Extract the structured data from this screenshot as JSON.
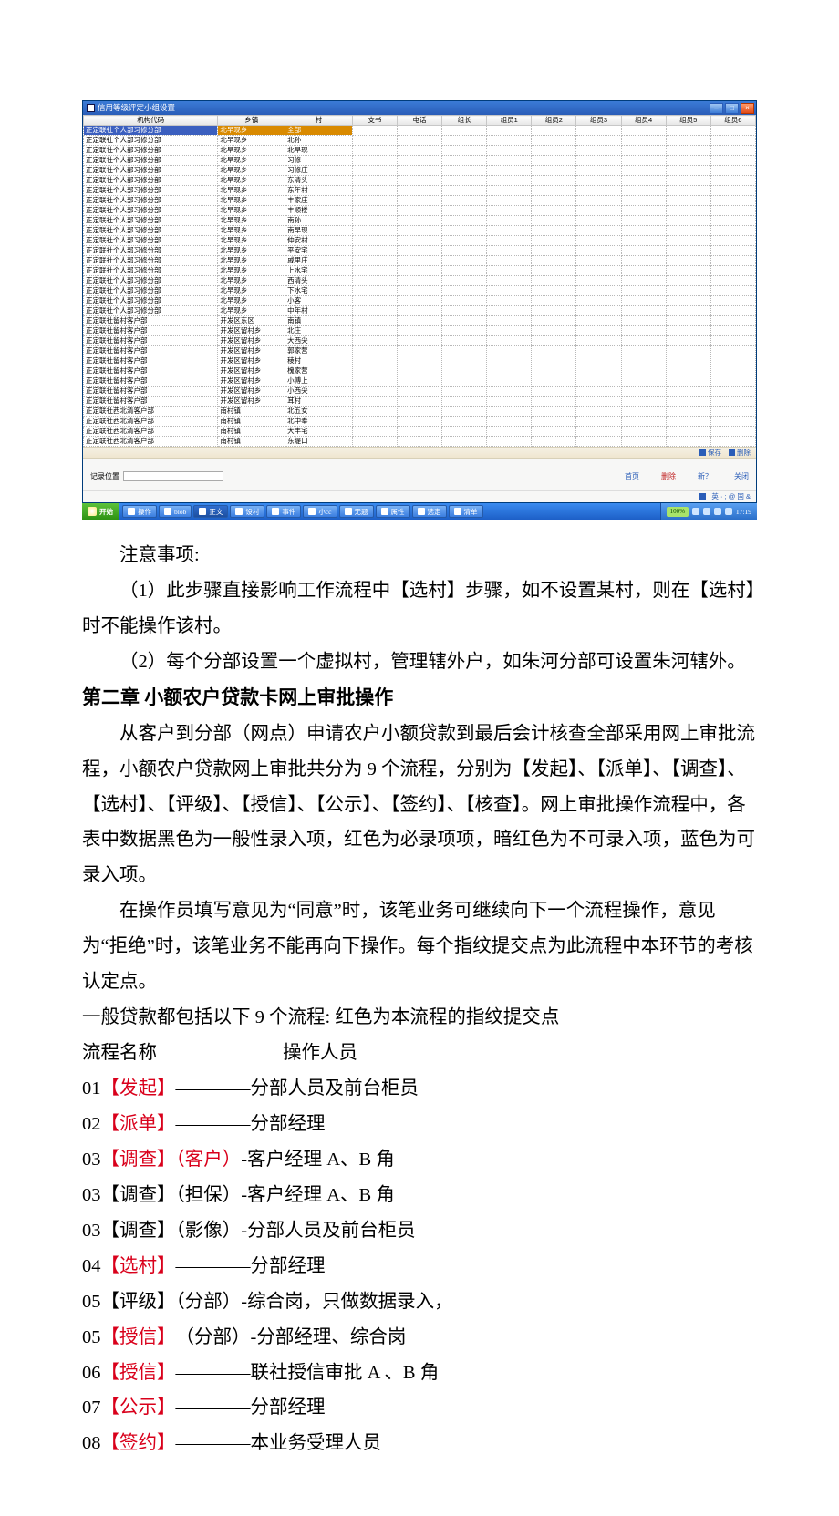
{
  "appWindow": {
    "title": "信用等级评定小组设置",
    "headers": [
      "机构代码",
      "乡镇",
      "村",
      "支书",
      "电话",
      "组长",
      "组员1",
      "组员2",
      "组员3",
      "组员4",
      "组员5",
      "组员6"
    ],
    "miniToolbar": {
      "save": "保存",
      "delete": "删除"
    },
    "rows": [
      {
        "org": "正定联社个人部习修分部",
        "town": "北早现乡",
        "village": "全部",
        "selected": true
      },
      {
        "org": "正定联社个人部习修分部",
        "town": "北早现乡",
        "village": "北孙"
      },
      {
        "org": "正定联社个人部习修分部",
        "town": "北早现乡",
        "village": "北早现"
      },
      {
        "org": "正定联社个人部习修分部",
        "town": "北早现乡",
        "village": "习修"
      },
      {
        "org": "正定联社个人部习修分部",
        "town": "北早现乡",
        "village": "习修庄"
      },
      {
        "org": "正定联社个人部习修分部",
        "town": "北早现乡",
        "village": "东清头"
      },
      {
        "org": "正定联社个人部习修分部",
        "town": "北早现乡",
        "village": "东年村"
      },
      {
        "org": "正定联社个人部习修分部",
        "town": "北早现乡",
        "village": "丰家庄"
      },
      {
        "org": "正定联社个人部习修分部",
        "town": "北早现乡",
        "village": "丰顺楼"
      },
      {
        "org": "正定联社个人部习修分部",
        "town": "北早现乡",
        "village": "南孙"
      },
      {
        "org": "正定联社个人部习修分部",
        "town": "北早现乡",
        "village": "南早现"
      },
      {
        "org": "正定联社个人部习修分部",
        "town": "北早现乡",
        "village": "仲安村"
      },
      {
        "org": "正定联社个人部习修分部",
        "town": "北早现乡",
        "village": "平安宅"
      },
      {
        "org": "正定联社个人部习修分部",
        "town": "北早现乡",
        "village": "戚里庄"
      },
      {
        "org": "正定联社个人部习修分部",
        "town": "北早现乡",
        "village": "上水宅"
      },
      {
        "org": "正定联社个人部习修分部",
        "town": "北早现乡",
        "village": "西清头"
      },
      {
        "org": "正定联社个人部习修分部",
        "town": "北早现乡",
        "village": "下水宅"
      },
      {
        "org": "正定联社个人部习修分部",
        "town": "北早现乡",
        "village": "小客"
      },
      {
        "org": "正定联社个人部习修分部",
        "town": "北早现乡",
        "village": "中年村"
      },
      {
        "org": "正定联社留村客户部",
        "town": "开发区东区",
        "village": "南镇"
      },
      {
        "org": "正定联社留村客户部",
        "town": "开发区留村乡",
        "village": "北庄"
      },
      {
        "org": "正定联社留村客户部",
        "town": "开发区留村乡",
        "village": "大西尖"
      },
      {
        "org": "正定联社留村客户部",
        "town": "开发区留村乡",
        "village": "郭家营"
      },
      {
        "org": "正定联社留村客户部",
        "town": "开发区留村乡",
        "village": "稜村"
      },
      {
        "org": "正定联社留村客户部",
        "town": "开发区留村乡",
        "village": "槐家营"
      },
      {
        "org": "正定联社留村客户部",
        "town": "开发区留村乡",
        "village": "小傅上"
      },
      {
        "org": "正定联社留村客户部",
        "town": "开发区留村乡",
        "village": "小西尖"
      },
      {
        "org": "正定联社留村客户部",
        "town": "开发区留村乡",
        "village": "耳村"
      },
      {
        "org": "正定联社西北清客户部",
        "town": "南村镇",
        "village": "北五女"
      },
      {
        "org": "正定联社西北清客户部",
        "town": "南村镇",
        "village": "北中奉"
      },
      {
        "org": "正定联社西北清客户部",
        "town": "南村镇",
        "village": "大丰宅"
      },
      {
        "org": "正定联社西北清客户部",
        "town": "南村镇",
        "village": "东堤口"
      }
    ],
    "recordPos": {
      "label": "记录位置",
      "value": ""
    },
    "footerBtns": {
      "prev": "首页",
      "del": "删除",
      "new": "新？",
      "close": "关闭"
    },
    "statusBottom": "英 · ; @ 国 &"
  },
  "taskbar": {
    "start": "开始",
    "tasks": [
      {
        "label": "操作",
        "active": false
      },
      {
        "label": "blob",
        "active": false
      },
      {
        "label": "正文",
        "active": true
      },
      {
        "label": "设村",
        "active": false
      },
      {
        "label": "事件",
        "active": false
      },
      {
        "label": "小cc",
        "active": false
      },
      {
        "label": "无题",
        "active": false
      },
      {
        "label": "属性",
        "active": false
      },
      {
        "label": "选定",
        "active": false
      },
      {
        "label": "清单",
        "active": false
      }
    ],
    "tray": {
      "pct": "100%",
      "time": "17:19"
    }
  },
  "body": {
    "noteHeader": "注意事项:",
    "note1": "（1）此步骤直接影响工作流程中【选村】步骤，如不设置某村，则在【选村】时不能操作该村。",
    "note2": "（2）每个分部设置一个虚拟村，管理辖外户，如朱河分部可设置朱河辖外。",
    "chapter": "第二章  小额农户贷款卡网上审批操作",
    "para1": "从客户到分部（网点）申请农户小额贷款到最后会计核查全部采用网上审批流程，小额农户贷款网上审批共分为 9 个流程，分别为【发起】、【派单】、【调查】、【选村】、【评级】、【授信】、【公示】、【签约】、【核查】。网上审批操作流程中，各表中数据黑色为一般性录入项，红色为必录项项，暗红色为不可录入项，蓝色为可录入项。",
    "para2": "在操作员填写意见为“同意”时，该笔业务可继续向下一个流程操作，意见为“拒绝”时，该笔业务不能再向下操作。每个指纹提交点为此流程中本环节的考核认定点。",
    "para3": "一般贷款都包括以下 9 个流程: 红色为本流程的指纹提交点",
    "flowHeaderA": "流程名称",
    "flowHeaderB": "操作人员",
    "flows": [
      {
        "num": "01",
        "stepRed": "【发起】",
        "stepBlack": "",
        "rest": "————分部人员及前台柜员"
      },
      {
        "num": "02",
        "stepRed": "【派单】",
        "stepBlack": "",
        "rest": "————分部经理"
      },
      {
        "num": "03",
        "stepRed": "【调查】（客户）",
        "stepBlack": "",
        "rest": "-客户经理 A、B 角"
      },
      {
        "num": "03",
        "stepRed": "",
        "stepBlack": "【调查】（担保）",
        "rest": "-客户经理 A、B 角"
      },
      {
        "num": "03",
        "stepRed": "",
        "stepBlack": "【调查】（影像）",
        "rest": "-分部人员及前台柜员"
      },
      {
        "num": "04",
        "stepRed": "【选村】",
        "stepBlack": "",
        "rest": "————分部经理"
      },
      {
        "num": "05",
        "stepRed": "",
        "stepBlack": "【评级】（分部）",
        "rest": "-综合岗，只做数据录入，"
      },
      {
        "num": "05",
        "stepRed": "【授信】",
        "stepBlack": "（分部）",
        "rest": "-分部经理、综合岗"
      },
      {
        "num": "06",
        "stepRed": "【授信】",
        "stepBlack": "",
        "rest": "————联社授信审批 A 、B 角"
      },
      {
        "num": "07",
        "stepRed": "【公示】",
        "stepBlack": "",
        "rest": "————分部经理"
      },
      {
        "num": "08",
        "stepRed": "【签约】",
        "stepBlack": "",
        "rest": "————本业务受理人员"
      }
    ]
  }
}
